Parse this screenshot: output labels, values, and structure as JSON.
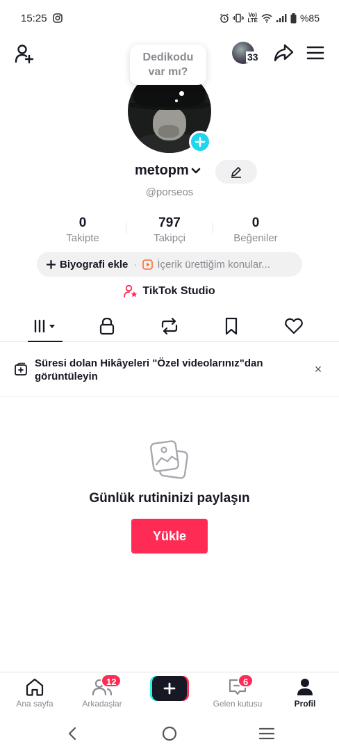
{
  "status_bar": {
    "time": "15:25",
    "battery": "%85",
    "network": "Vo) LTE"
  },
  "top_bar": {
    "story_count": "33"
  },
  "bubble": {
    "line1": "Dedikodu",
    "line2": "var mı?"
  },
  "profile": {
    "display_name": "metopm",
    "username": "@porseos"
  },
  "stats": [
    {
      "value": "0",
      "label": "Takipte"
    },
    {
      "value": "797",
      "label": "Takipçi"
    },
    {
      "value": "0",
      "label": "Beğeniler"
    }
  ],
  "bio_bar": {
    "add_bio": "Biyografi ekle",
    "separator": "·",
    "topics": "İçerik ürettiğim konular..."
  },
  "studio": {
    "label": "TikTok Studio"
  },
  "tabs": [
    "videos-grid",
    "private",
    "reposts",
    "saved",
    "liked"
  ],
  "notice": {
    "text": "Süresi dolan Hikâyeleri \"Özel videolarınız\"dan görüntüleyin",
    "close": "×"
  },
  "empty_state": {
    "title": "Günlük rutininizi paylaşın",
    "upload_label": "Yükle"
  },
  "bottom_nav": {
    "home": "Ana sayfa",
    "friends": "Arkadaşlar",
    "friends_badge": "12",
    "inbox": "Gelen kutusu",
    "inbox_badge": "6",
    "profile": "Profil"
  },
  "colors": {
    "accent": "#fe2c55",
    "cyan": "#25f4ee",
    "text": "#161823",
    "muted": "#8a8b91"
  }
}
